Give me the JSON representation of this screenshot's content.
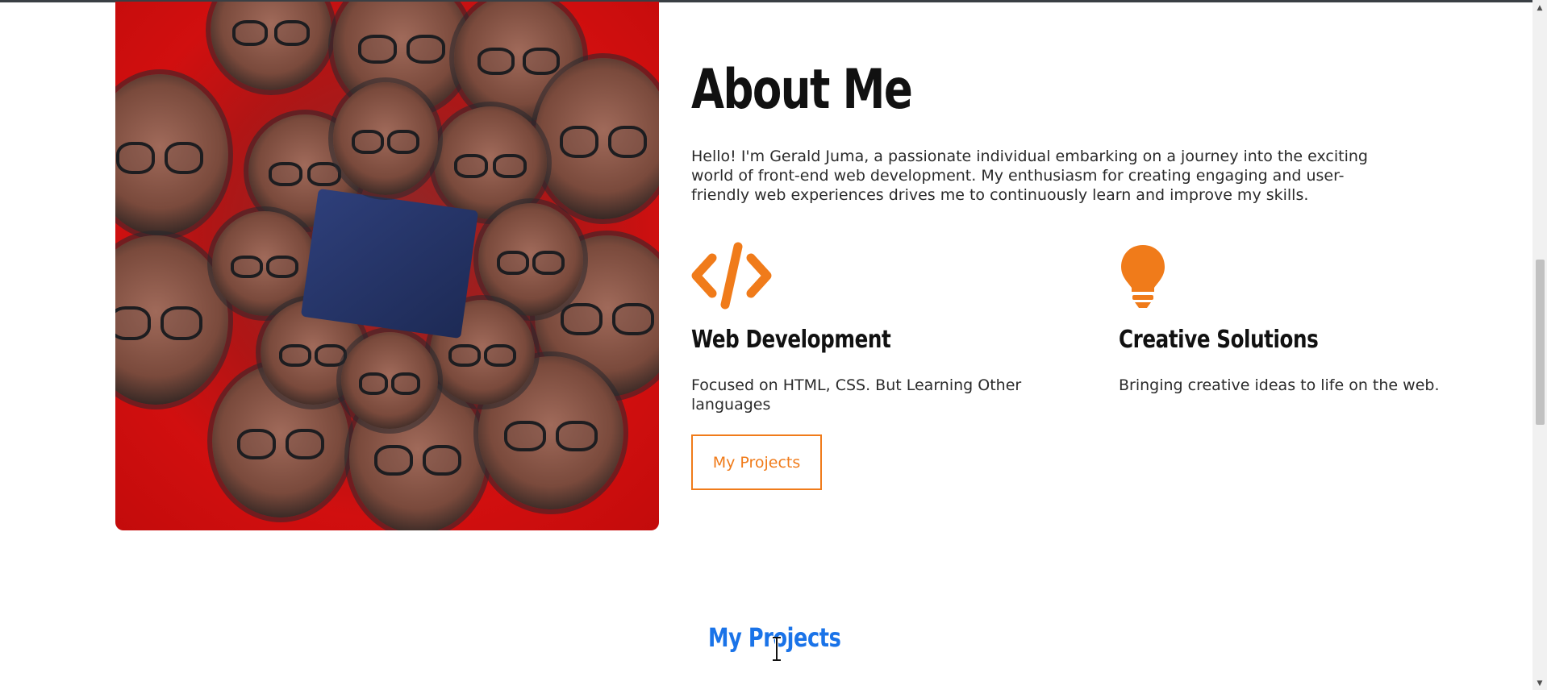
{
  "about": {
    "title": "About Me",
    "intro": "Hello! I'm Gerald Juma, a passionate individual embarking on a journey into the exciting world of front-end web development. My enthusiasm for creating engaging and user-friendly web experiences drives me to continuously learn and improve my skills.",
    "photo_icon": "kaleidoscope-portrait-photo"
  },
  "features": [
    {
      "icon": "code-icon",
      "title": "Web Development",
      "description": "Focused on HTML, CSS. But Learning Other languages"
    },
    {
      "icon": "lightbulb-icon",
      "title": "Creative Solutions",
      "description": "Bringing creative ideas to life on the web."
    }
  ],
  "buttons": {
    "projects_label": "My Projects"
  },
  "projects_section": {
    "heading": "My Projects"
  },
  "colors": {
    "accent": "#f07b1a",
    "heading_link": "#1a73e8",
    "photo_background": "#c30b0b",
    "text": "#2b2b2b"
  }
}
